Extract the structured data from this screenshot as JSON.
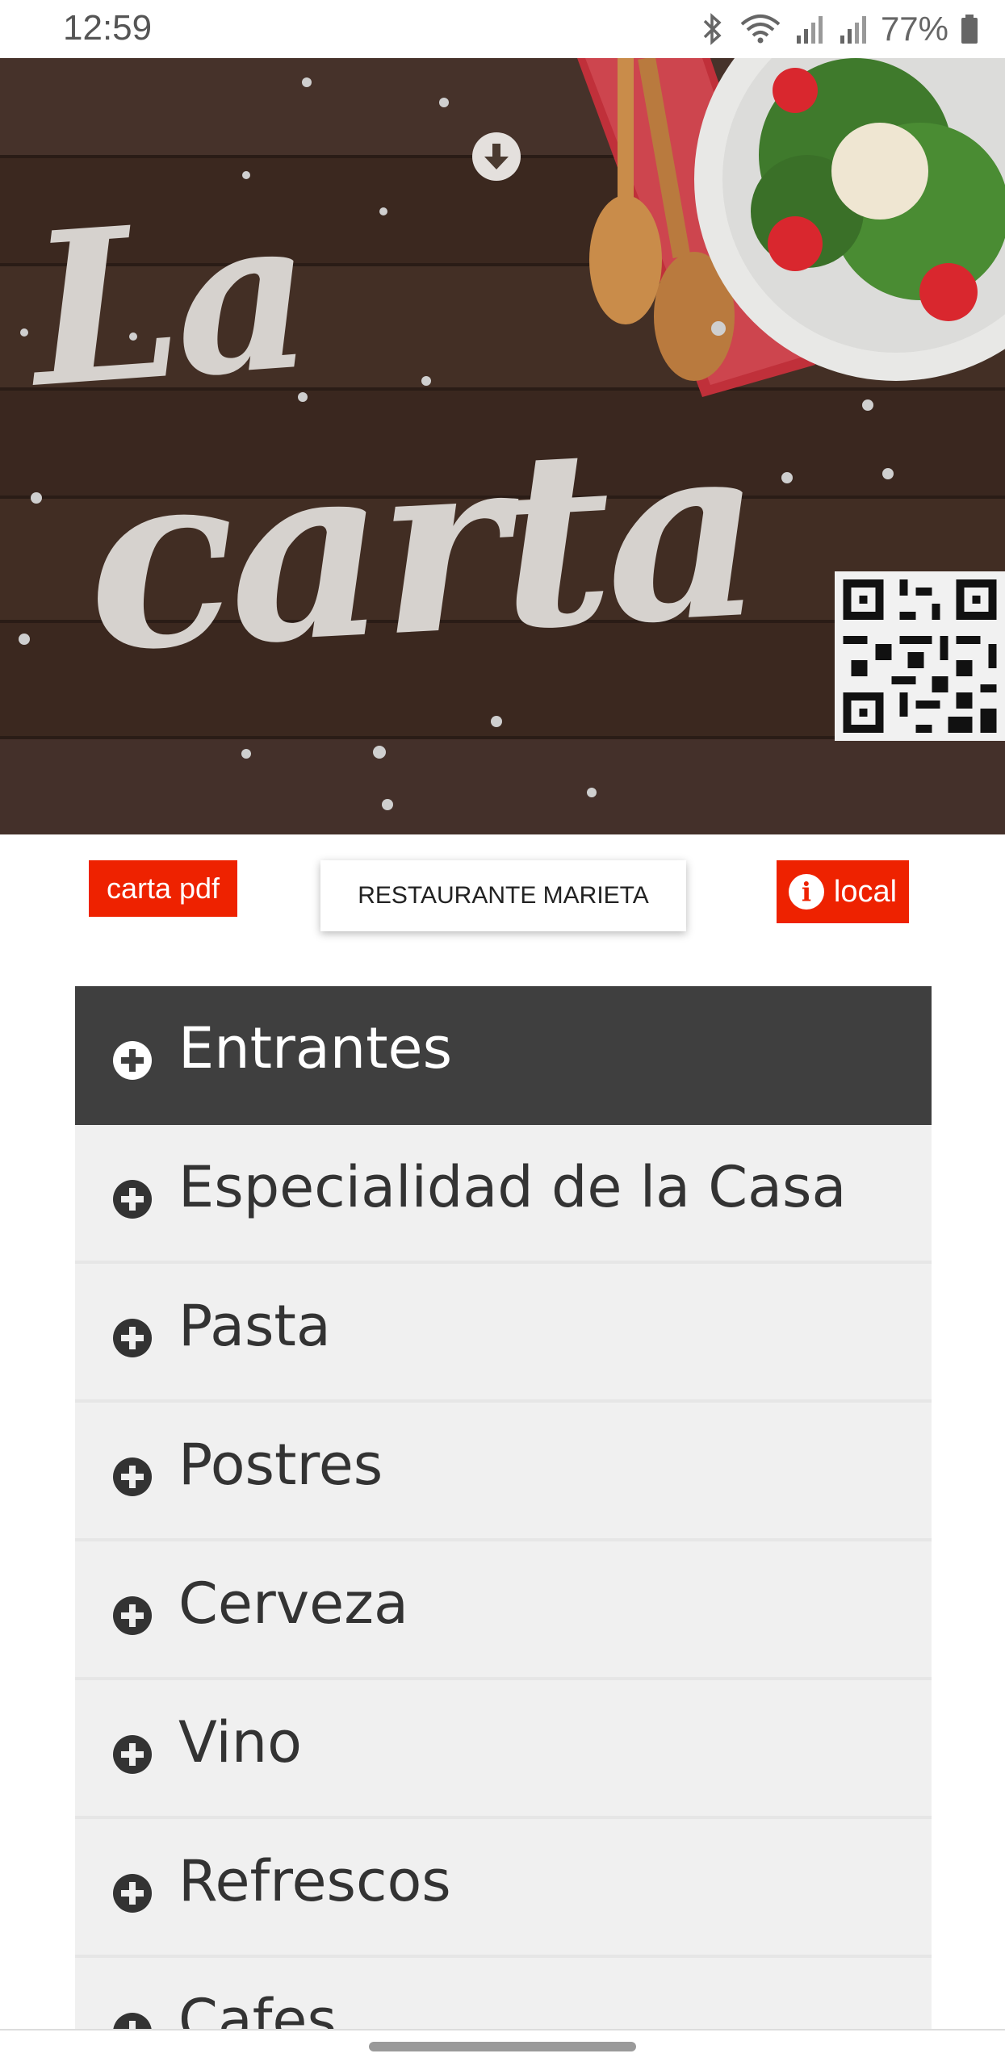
{
  "status_bar": {
    "time": "12:59",
    "battery": "77%"
  },
  "hero": {
    "title_line1": "La",
    "title_line2": "carta"
  },
  "actions": {
    "carta_pdf": "carta pdf",
    "restaurant": "RESTAURANTE MARIETA",
    "local": "local"
  },
  "menu": {
    "items": [
      {
        "label": "Entrantes",
        "active": true
      },
      {
        "label": "Especialidad de la Casa"
      },
      {
        "label": "Pasta"
      },
      {
        "label": "Postres"
      },
      {
        "label": "Cerveza"
      },
      {
        "label": "Vino"
      },
      {
        "label": "Refrescos"
      },
      {
        "label": "Cafes"
      }
    ]
  },
  "colors": {
    "accent_red": "#ee2200",
    "active_header": "#3f3f3f",
    "item_bg": "#f0f0f0"
  }
}
